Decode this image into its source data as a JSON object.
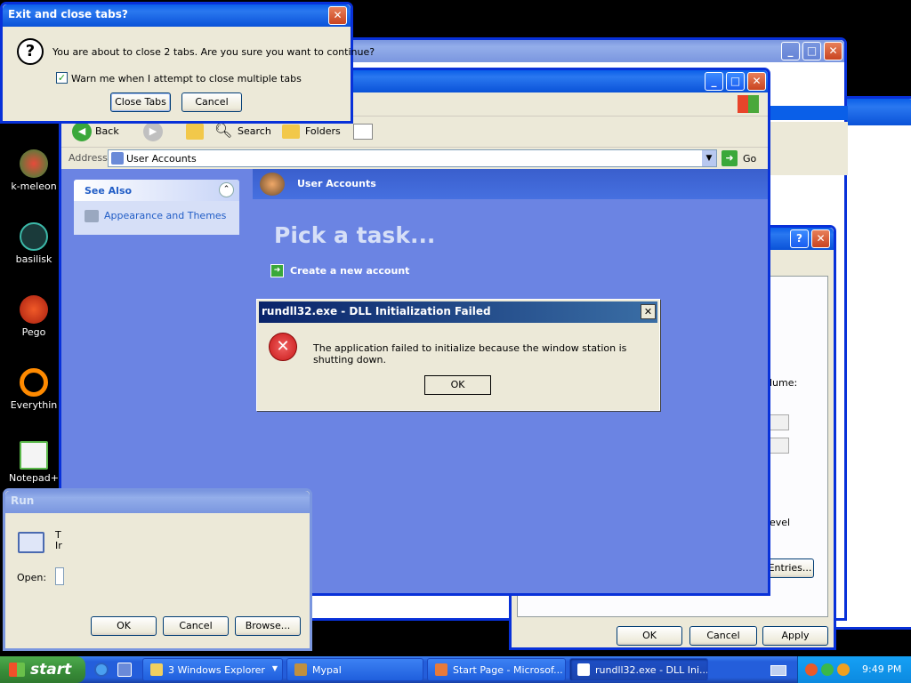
{
  "desktop": {
    "icons": [
      {
        "label": "k-meleon"
      },
      {
        "label": "basilisk"
      },
      {
        "label": "Pego"
      },
      {
        "label": "Everythin"
      },
      {
        "label": "Notepad+"
      }
    ]
  },
  "exit_dialog": {
    "title": "Exit and close tabs?",
    "message": "You are about to close 2 tabs. Are you sure you want to continue?",
    "checkbox_label": "Warn me when I attempt to close multiple tabs",
    "close_tabs_label": "Close Tabs",
    "cancel_label": "Cancel",
    "help_glyph": "?"
  },
  "explorer": {
    "toolbar": {
      "back_label": "Back",
      "search_label": "Search",
      "folders_label": "Folders"
    },
    "address": {
      "label": "Address",
      "value": "User Accounts",
      "go_label": "Go"
    },
    "see_also": {
      "title": "See Also",
      "items": [
        "Appearance and Themes"
      ]
    },
    "header_title": "User Accounts",
    "pick_task": "Pick a task...",
    "tasks": [
      "Create a new account"
    ]
  },
  "error_dialog": {
    "title": "rundll32.exe - DLL Initialization Failed",
    "message": "The application failed to initialize because the window station is shutting down.",
    "ok_label": "OK"
  },
  "run_dialog": {
    "title": "Run",
    "open_label": "Open:",
    "text_fragment": "T\nIr",
    "ok_label": "OK",
    "cancel_label": "Cancel",
    "browse_label": "Browse..."
  },
  "props_dialog": {
    "ok_label": "OK",
    "cancel_label": "Cancel",
    "apply_label": "Apply",
    "entries_label": "Entries...",
    "volume_fragment": "lume:",
    "level_fragment": "evel",
    "help_glyph": "?"
  },
  "taskbar": {
    "start_label": "start",
    "items": [
      {
        "label": "3 Windows Explorer"
      },
      {
        "label": "Mypal"
      },
      {
        "label": "Start Page - Microsof..."
      },
      {
        "label": "rundll32.exe - DLL Ini..."
      }
    ],
    "clock": "9:49 PM"
  },
  "colors": {
    "taskbar": "#245edb",
    "title_active": "#0a5fe8",
    "explorer_bg": "#6b84e3",
    "error_icon": "#d8261c"
  }
}
